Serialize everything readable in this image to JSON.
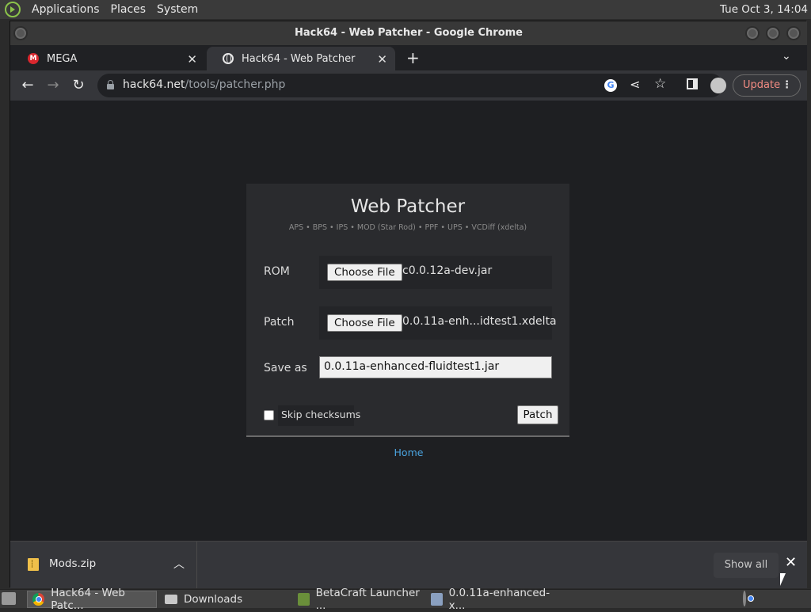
{
  "top_panel": {
    "menus": [
      "Applications",
      "Places",
      "System"
    ],
    "clock": "Tue Oct  3, 14:04"
  },
  "window": {
    "title": "Hack64 - Web Patcher - Google Chrome"
  },
  "tabs": [
    {
      "title": "MEGA",
      "icon": "mega-icon",
      "active": false
    },
    {
      "title": "Hack64 - Web Patcher",
      "icon": "globe-icon",
      "active": true
    }
  ],
  "toolbar": {
    "url_host": "hack64.net",
    "url_path": "/tools/patcher.php",
    "update_label": "Update"
  },
  "page": {
    "title": "Web Patcher",
    "subtitle": "APS • BPS • IPS • MOD (Star Rod) • PPF • UPS • VCDiff (xdelta)",
    "rom": {
      "label": "ROM",
      "button": "Choose File",
      "filename": "c0.0.12a-dev.jar"
    },
    "patch": {
      "label": "Patch",
      "button": "Choose File",
      "filename": "0.0.11a-enh...idtest1.xdelta"
    },
    "save_as": {
      "label": "Save as",
      "value": "0.0.11a-enhanced-fluidtest1.jar"
    },
    "skip_checksums": {
      "label": "Skip checksums",
      "checked": false
    },
    "patch_button": "Patch",
    "home_link": "Home"
  },
  "download_shelf": {
    "file": "Mods.zip",
    "show_all": "Show all"
  },
  "taskbar": {
    "items": [
      {
        "label": "Hack64 - Web Patc...",
        "icon": "chrome-icon",
        "active": true
      },
      {
        "label": "Downloads",
        "icon": "folder-icon",
        "active": false
      },
      {
        "label": "BetaCraft Launcher ...",
        "icon": "launcher-icon",
        "active": false
      },
      {
        "label": "0.0.11a-enhanced-x...",
        "icon": "file-icon",
        "active": false
      }
    ]
  }
}
